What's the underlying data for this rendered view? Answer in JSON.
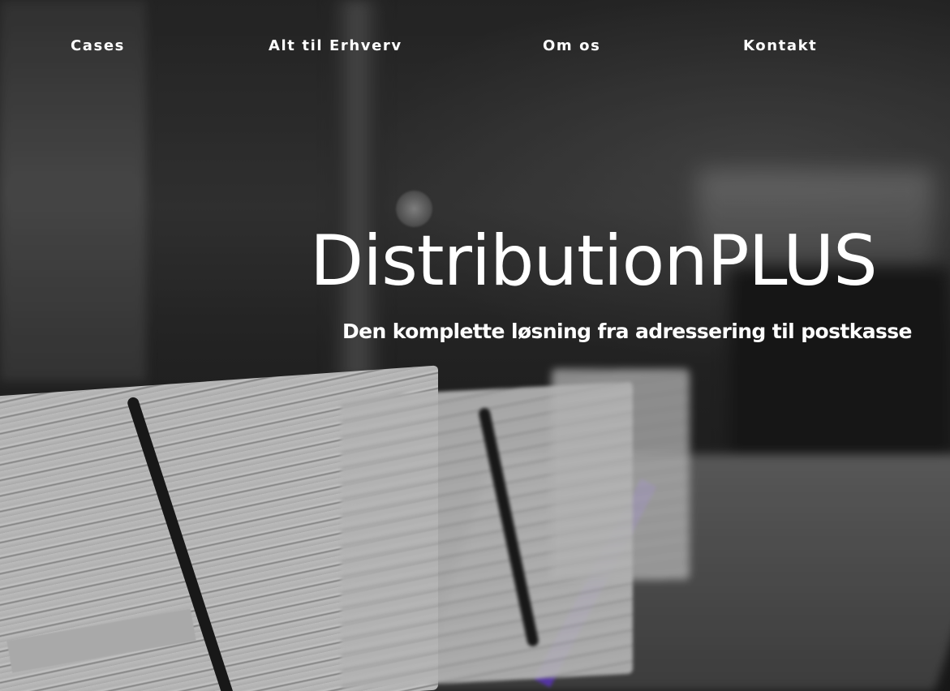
{
  "nav": {
    "items": [
      {
        "label": "Cases"
      },
      {
        "label": "Alt til Erhverv"
      },
      {
        "label": "Om os"
      },
      {
        "label": "Kontakt"
      }
    ]
  },
  "hero": {
    "title": "DistributionPLUS",
    "subtitle": "Den komplette løsning fra adressering til postkasse",
    "background_image": "newspaper-stacks-photo",
    "colors": {
      "text": "#ffffff",
      "accent": "#6a3fd6"
    }
  }
}
